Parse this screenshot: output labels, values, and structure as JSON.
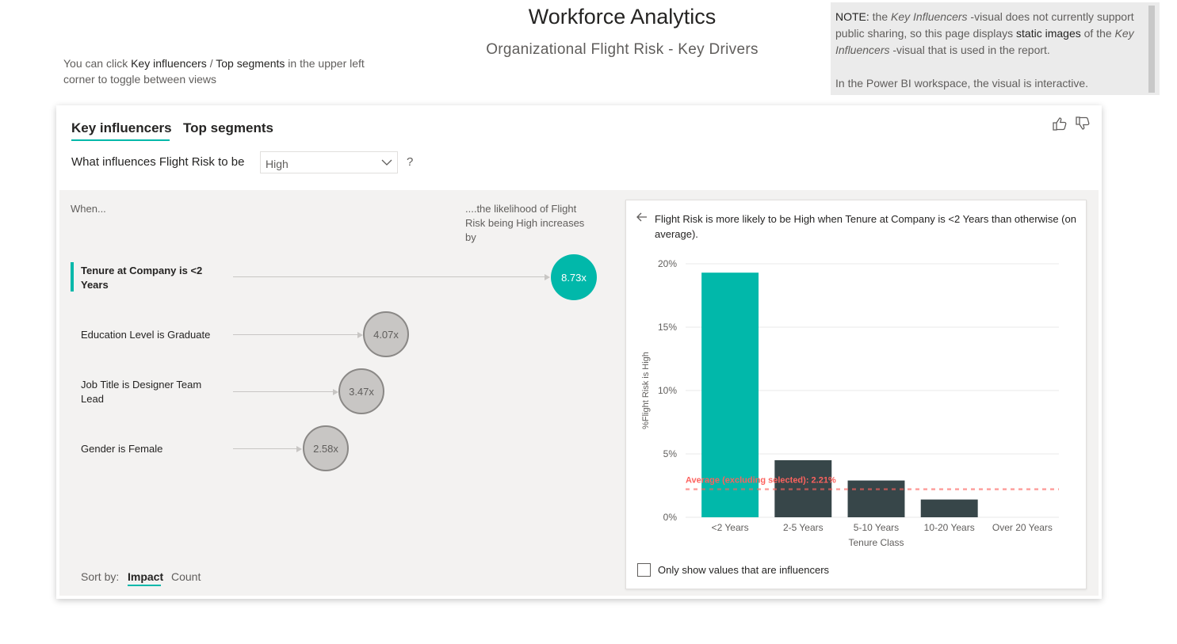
{
  "header": {
    "title": "Workforce Analytics",
    "subtitle": "Organizational Flight Risk - Key Drivers"
  },
  "hint": {
    "prefix": "You can click ",
    "key_influencers": "Key influencers",
    "separator": " / ",
    "top_segments": "Top segments",
    "suffix": " in the upper left corner to toggle between views"
  },
  "note": {
    "label": "NOTE:",
    "part1": " the ",
    "visual_name": "Key Influencers",
    "part2": " -visual does not currently support public sharing, so this page displays ",
    "static_images": "static images",
    "part3": " of the ",
    "part4": " -visual that is used in the report.",
    "para2": "In the Power BI workspace, the visual is interactive."
  },
  "visual": {
    "tabs": [
      {
        "label": "Key influencers",
        "active": true
      },
      {
        "label": "Top segments",
        "active": false
      }
    ],
    "icons": [
      "thumbs-up-icon",
      "thumbs-down-icon"
    ],
    "question_label": "What influences Flight Risk to be",
    "dropdown_value": "High",
    "question_mark": "?",
    "when_label": "When...",
    "likelihood_label": "....the likelihood of Flight Risk being High increases by",
    "influencers": [
      {
        "label": "Tenure at Company is <2 Years",
        "value": "8.73x",
        "selected": true
      },
      {
        "label": "Education Level is Graduate",
        "value": "4.07x",
        "selected": false
      },
      {
        "label": "Job Title is Designer Team Lead",
        "value": "3.47x",
        "selected": false
      },
      {
        "label": "Gender is Female",
        "value": "2.58x",
        "selected": false
      }
    ],
    "sort": {
      "label": "Sort by:",
      "impact": "Impact",
      "count": "Count",
      "active": "Impact"
    },
    "detail": {
      "text": "Flight Risk is more likely to be High when Tenure at Company is <2 Years than otherwise (on average).",
      "checkbox_label": "Only show values that are influencers",
      "checkbox_checked": false
    },
    "colors": {
      "accent": "#01b8aa",
      "dark_bar": "#374649",
      "average_line": "#fd625e"
    }
  },
  "chart_data": {
    "type": "bar",
    "categories": [
      "<2 Years",
      "2-5 Years",
      "5-10 Years",
      "10-20 Years",
      "Over 20 Years"
    ],
    "values": [
      19.3,
      4.5,
      2.9,
      1.4,
      0
    ],
    "highlight_index": 0,
    "xlabel": "Tenure Class",
    "ylabel": "%Flight Risk is High",
    "ylim": [
      0,
      20
    ],
    "yticks": [
      "0%",
      "5%",
      "10%",
      "15%",
      "20%"
    ],
    "ytick_values": [
      0,
      5,
      10,
      15,
      20
    ],
    "average_line": {
      "value": 2.21,
      "label": "Average (excluding selected): 2.21%"
    },
    "grid": true
  }
}
